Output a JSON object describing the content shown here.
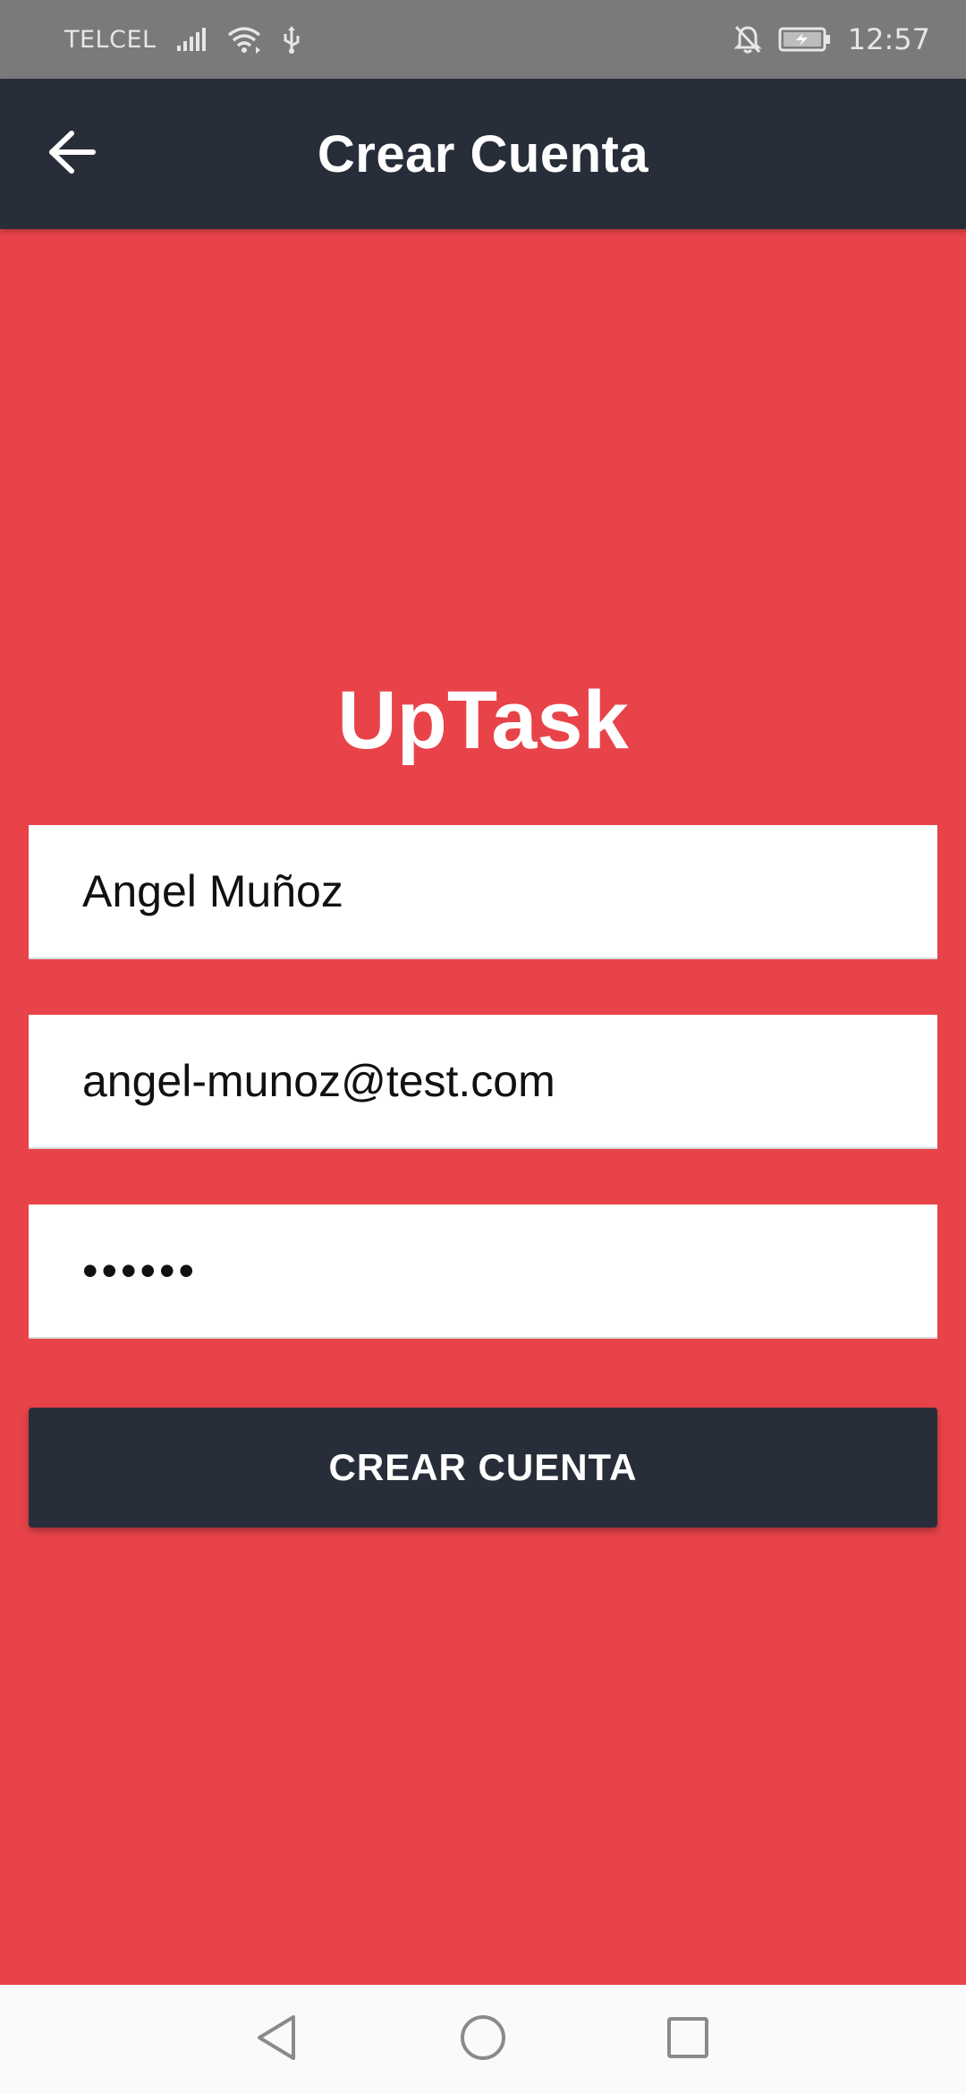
{
  "status_bar": {
    "carrier": "TELCEL",
    "time": "12:57",
    "icons": [
      "signal-icon",
      "wifi-icon",
      "usb-icon",
      "notifications-off-icon",
      "battery-charging-icon"
    ]
  },
  "app_bar": {
    "title": "Crear Cuenta",
    "back_icon": "arrow-back-icon"
  },
  "brand": {
    "title": "UpTask"
  },
  "form": {
    "name_value": "Angel Muñoz",
    "email_value": "angel-munoz@test.com",
    "password_value": "••••••",
    "submit_label": "CREAR CUENTA"
  },
  "nav_bar": {
    "icons": [
      "nav-back-icon",
      "nav-home-icon",
      "nav-recents-icon"
    ]
  },
  "colors": {
    "background": "#e84349",
    "app_bar": "#272e39",
    "button": "#272e39",
    "status_bar": "#7a7a7a"
  }
}
